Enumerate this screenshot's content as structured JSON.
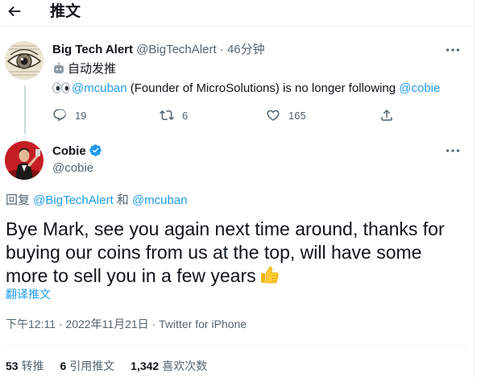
{
  "header": {
    "title": "推文",
    "back_icon": "arrow-left-icon"
  },
  "tweet1": {
    "name": "Big Tech Alert",
    "handle": "@BigTechAlert",
    "separator": "·",
    "time": "46分钟",
    "auto_label": "自动发推",
    "text_mention1": "@mcuban",
    "text_middle": " (Founder of MicroSolutions) is no longer following ",
    "text_mention2": "@cobie",
    "replies": "19",
    "retweets": "6",
    "likes": "165"
  },
  "tweet2": {
    "name": "Cobie",
    "handle": "@cobie",
    "reply_prefix": "回复 ",
    "reply_user1": "@BigTechAlert",
    "reply_and": " 和 ",
    "reply_user2": "@mcuban",
    "body": "Bye Mark, see you again next time around, thanks for buying our coins from us at the top, will have some more to sell you in a few years",
    "translate_label": "翻译推文",
    "timestamp": "下午12:11 · 2022年11月21日 · Twitter for iPhone",
    "retweets_count": "53",
    "retweets_label": "转推",
    "quotes_count": "6",
    "quotes_label": "引用推文",
    "likes_count": "1,342",
    "likes_label": "喜欢次数"
  },
  "colors": {
    "accent": "#1d9bf0",
    "secondary_text": "#536471",
    "border": "#eff3f4"
  }
}
